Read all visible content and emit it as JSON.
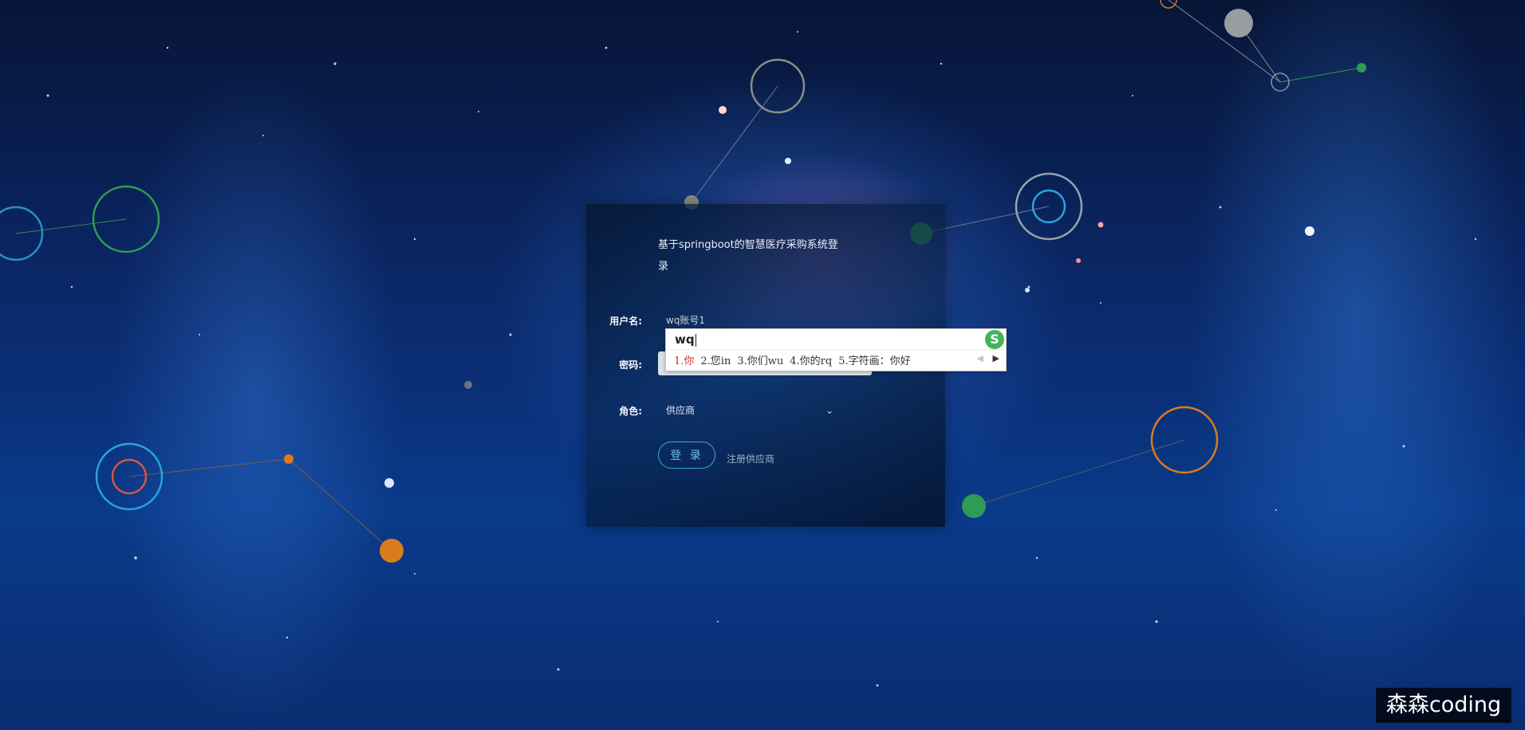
{
  "login": {
    "title": "基于springboot的智慧医疗采购系统登录",
    "username_label": "用户名:",
    "username_value": "wq账号1",
    "password_label": "密码:",
    "password_value": "",
    "role_label": "角色:",
    "role_value": "供应商",
    "login_button": "登 录",
    "register_link": "注册供应商"
  },
  "ime": {
    "input_code": "wq",
    "candidates": [
      "1.你",
      "2.您in",
      "3.你们wu",
      "4.你的rq",
      "5.字符画：你好"
    ],
    "logo": "S",
    "prev_icon": "triangle-left-icon",
    "next_icon": "triangle-right-icon"
  },
  "watermark": "森森coding",
  "colors": {
    "accent": "#3fa7e0",
    "ime_highlight": "#d0312d",
    "ime_logo": "#46b25a"
  }
}
